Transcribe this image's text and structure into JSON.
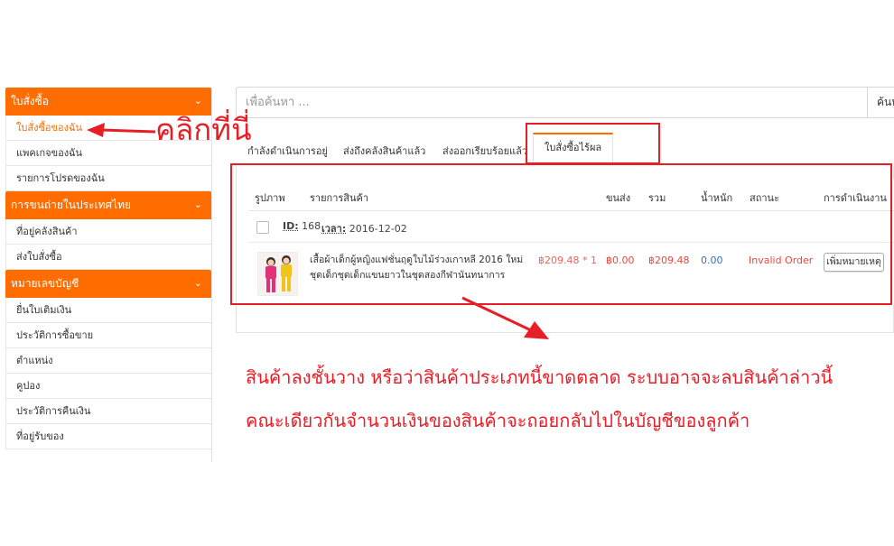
{
  "sidebar": {
    "sections": [
      {
        "title": "ใบสั่งซื้อ",
        "items": [
          {
            "label": "ใบสั่งซื้อของฉัน",
            "active": true
          },
          {
            "label": "แพคเกจของฉัน",
            "active": false
          },
          {
            "label": "รายการโปรดของฉัน",
            "active": false
          }
        ]
      },
      {
        "title": "การขนถ่ายในประเทศไทย",
        "items": [
          {
            "label": "ที่อยู่คลังสินค้า",
            "active": false
          },
          {
            "label": "ส่งใบสั่งซื้อ",
            "active": false
          }
        ]
      },
      {
        "title": "หมายเลขบัญชี",
        "items": [
          {
            "label": "ยื่นใบเติมเงิน",
            "active": false
          },
          {
            "label": "ประวัติการซื้อขาย",
            "active": false
          },
          {
            "label": "ตำแหน่ง",
            "active": false
          },
          {
            "label": "คูปอง",
            "active": false
          },
          {
            "label": "ประวัติการคืนเงิน",
            "active": false
          },
          {
            "label": "ที่อยู่รับของ",
            "active": false
          }
        ]
      }
    ],
    "accent_color": "#ff6d00"
  },
  "search": {
    "placeholder": "เพื่อค้นหา ...",
    "button_label": "ค้นหา"
  },
  "tabs": [
    {
      "label": "กำลังดำเนินการอยู่",
      "active": false
    },
    {
      "label": "ส่งถึงคลังสินค้าแล้ว",
      "active": false
    },
    {
      "label": "ส่งออกเรียบร้อยแล้ว",
      "active": false
    },
    {
      "label": "ใบสั่งซื้อไร้ผล",
      "active": true
    }
  ],
  "table": {
    "columns": [
      "รูปภาพ",
      "รายการสินค้า",
      "ขนส่ง",
      "รวม",
      "น้ำหนัก",
      "สถานะ",
      "การดำเนินงาน"
    ],
    "order": {
      "id_label": "ID:",
      "id_value": "168",
      "time_label": "เวลา:",
      "time_value": "2016-12-02"
    },
    "row": {
      "product_name": "เสื้อผ้าเด็กผู้หญิงแฟชั่นฤดูใบไม้ร่วงเกาหลี 2016 ใหม่ชุดเด็กชุดเด็กแขนยาวในชุดสองกีฬานันทนาการ",
      "price_qty": "฿209.48 * 1",
      "shipping": "฿0.00",
      "total": "฿209.48",
      "weight": "0.00",
      "status": "Invalid Order",
      "action_label": "เพิ่มหมายเหตุ"
    }
  },
  "annotations": {
    "click_here": "คลิกที่นี่",
    "line1": "สินค้าลงชั้นวาง หรือว่าสินค้าประเภทนี้ขาดตลาด  ระบบอาจจะลบสินค้าล่าวนี้",
    "line2": "คณะเดียวกันจำนวนเงินของสินค้าจะถอยกลับไปในบัญชีของลูกค้า",
    "color": "#e81e26"
  }
}
